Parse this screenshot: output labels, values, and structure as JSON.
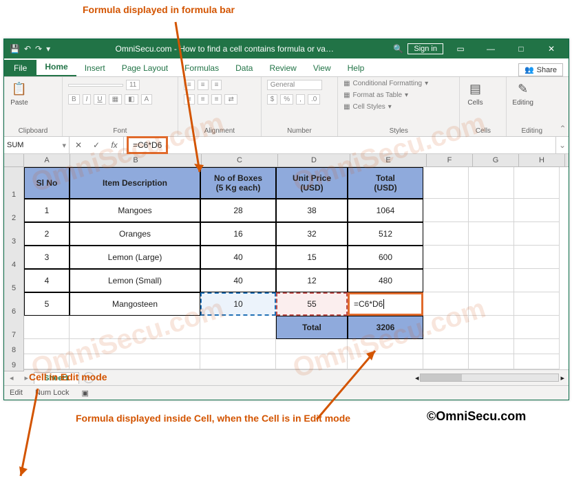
{
  "annotations": {
    "top": "Formula displayed  in formula bar",
    "editmode": "Cell in Edit mode",
    "inside": "Formula displayed inside Cell, when the Cell is in Edit mode",
    "credit": "©OmniSecu.com"
  },
  "title_bar": {
    "doc_title": "OmniSecu.com - How to find a cell contains formula or va…",
    "sign_in": "Sign in"
  },
  "tabs": {
    "file": "File",
    "home": "Home",
    "insert": "Insert",
    "page_layout": "Page Layout",
    "formulas": "Formulas",
    "data": "Data",
    "review": "Review",
    "view": "View",
    "help": "Help",
    "share": "Share"
  },
  "ribbon": {
    "clipboard": {
      "label": "Clipboard",
      "paste": "Paste"
    },
    "font": {
      "label": "Font",
      "size": "11",
      "b": "B",
      "i": "I",
      "u": "U"
    },
    "alignment": {
      "label": "Alignment"
    },
    "number": {
      "label": "Number",
      "format": "General"
    },
    "styles": {
      "label": "Styles",
      "cf": "Conditional Formatting",
      "fat": "Format as Table",
      "cs": "Cell Styles"
    },
    "cells": {
      "label": "Cells",
      "btn": "Cells"
    },
    "editing": {
      "label": "Editing",
      "btn": "Editing"
    }
  },
  "formula_bar": {
    "name_box": "SUM",
    "fx_label": "fx",
    "formula": "=C6*D6"
  },
  "columns": [
    "A",
    "B",
    "C",
    "D",
    "E",
    "F",
    "G",
    "H"
  ],
  "headers": {
    "a": "Sl No",
    "b": "Item Description",
    "c1": "No of Boxes",
    "c2": "(5 Kg each)",
    "d1": "Unit Price",
    "d2": "(USD)",
    "e1": "Total",
    "e2": "(USD)"
  },
  "rows": [
    {
      "n": "1",
      "a": "1",
      "b": "Mangoes",
      "c": "28",
      "d": "38",
      "e": "1064"
    },
    {
      "n": "2",
      "a": "2",
      "b": "Oranges",
      "c": "16",
      "d": "32",
      "e": "512"
    },
    {
      "n": "3",
      "a": "3",
      "b": "Lemon (Large)",
      "c": "40",
      "d": "15",
      "e": "600"
    },
    {
      "n": "4",
      "a": "4",
      "b": "Lemon (Small)",
      "c": "40",
      "d": "12",
      "e": "480"
    },
    {
      "n": "5",
      "a": "5",
      "b": "Mangosteen",
      "c": "10",
      "d": "55",
      "e": "=C6*D6"
    }
  ],
  "footer": {
    "label": "Total",
    "value": "3206"
  },
  "row_numbers_extra": [
    "7",
    "8",
    "9"
  ],
  "sheet_tabs": {
    "sheet": "Sheet1"
  },
  "status_bar": {
    "mode": "Edit",
    "numlock": "Num Lock"
  },
  "watermark": "OmniSecu.com"
}
